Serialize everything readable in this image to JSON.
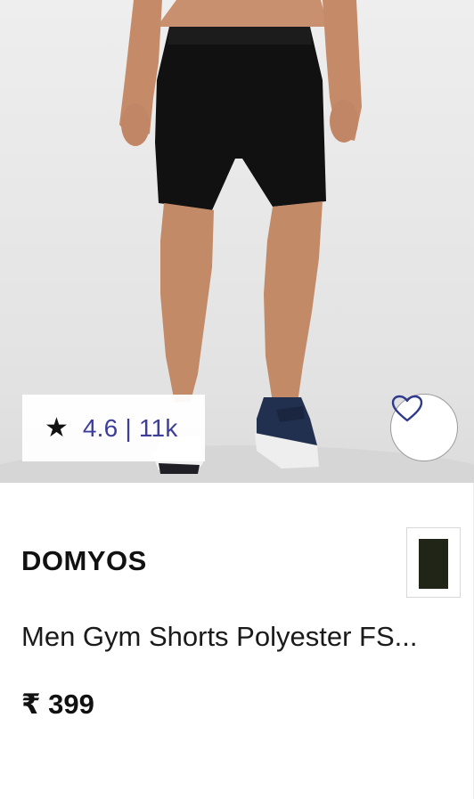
{
  "product": {
    "image_alt": "Men Gym Shorts Polyester FS",
    "rating_star": "★",
    "rating_text": "4.6 | 11k",
    "brand": "DOMYOS",
    "title": "Men Gym Shorts Polyester FS...",
    "price": "₹ 399",
    "swatch_color": "#212517"
  },
  "icons": {
    "wishlist": "heart-outline-icon",
    "rating": "star-icon"
  },
  "colors": {
    "rating_text": "#3d3d9a",
    "wishlist_stroke": "#2f3a8f"
  }
}
